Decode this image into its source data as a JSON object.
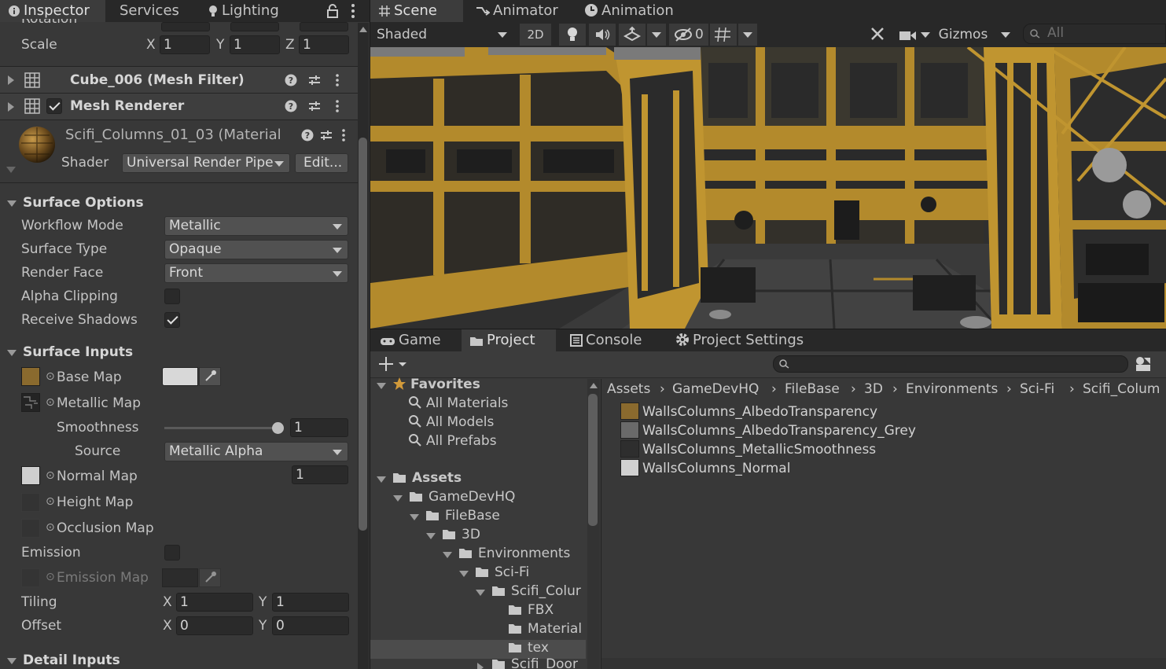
{
  "inspector": {
    "tabs": [
      "Inspector",
      "Services",
      "Lighting"
    ],
    "partial_row_label": "Rotation",
    "scale": {
      "label": "Scale",
      "x": "1",
      "y": "1",
      "z": "1"
    },
    "components": [
      {
        "name": "Cube_006 (Mesh Filter)"
      },
      {
        "name": "Mesh Renderer"
      }
    ],
    "material": {
      "name": "Scifi_Columns_01_03 (Material",
      "shader_label": "Shader",
      "shader_value": "Universal Render Pipe",
      "edit_label": "Edit..."
    },
    "surface_options": {
      "header": "Surface Options",
      "workflow_mode": {
        "label": "Workflow Mode",
        "value": "Metallic"
      },
      "surface_type": {
        "label": "Surface Type",
        "value": "Opaque"
      },
      "render_face": {
        "label": "Render Face",
        "value": "Front"
      },
      "alpha_clipping": {
        "label": "Alpha Clipping",
        "checked": false
      },
      "receive_shadows": {
        "label": "Receive Shadows",
        "checked": true
      }
    },
    "surface_inputs": {
      "header": "Surface Inputs",
      "base_map": "Base Map",
      "metallic_map": "Metallic Map",
      "smoothness": {
        "label": "Smoothness",
        "value": "1",
        "level": 1.0
      },
      "source": {
        "label": "Source",
        "value": "Metallic Alpha"
      },
      "normal_map": {
        "label": "Normal Map",
        "value": "1"
      },
      "height_map": "Height Map",
      "occlusion_map": "Occlusion Map",
      "emission": "Emission",
      "emission_map": "Emission Map",
      "tiling": {
        "label": "Tiling",
        "x": "1",
        "y": "1"
      },
      "offset": {
        "label": "Offset",
        "x": "0",
        "y": "0"
      }
    },
    "detail_inputs": {
      "header": "Detail Inputs"
    },
    "axis_labels": {
      "x": "X",
      "y": "Y",
      "z": "Z"
    }
  },
  "scene": {
    "tabs": [
      "Scene",
      "Animator",
      "Animation"
    ],
    "shading_mode": "Shaded",
    "mode_2d": "2D",
    "hidden_count": "0",
    "gizmos": "Gizmos",
    "search_placeholder": "All"
  },
  "project": {
    "tabs": [
      "Game",
      "Project",
      "Console",
      "Project Settings"
    ],
    "favorites": {
      "label": "Favorites",
      "items": [
        "All Materials",
        "All Models",
        "All Prefabs"
      ]
    },
    "tree": {
      "assets": "Assets",
      "gamedevhq": "GameDevHQ",
      "filebase": "FileBase",
      "three_d": "3D",
      "environments": "Environments",
      "scifi": "Sci-Fi",
      "scifi_columns": "Scifi_Colur",
      "fbx": "FBX",
      "material": "Material",
      "tex": "tex",
      "scifi_door": "Scifi_Door"
    },
    "breadcrumb": [
      "Assets",
      "GameDevHQ",
      "FileBase",
      "3D",
      "Environments",
      "Sci-Fi",
      "Scifi_Colum"
    ],
    "files": [
      {
        "name": "WallsColumns_AlbedoTransparency",
        "color": "#8a6a2e"
      },
      {
        "name": "WallsColumns_AlbedoTransparency_Grey",
        "color": "#6a6a6a"
      },
      {
        "name": "WallsColumns_MetallicSmoothness",
        "color": "#2e2e2e"
      },
      {
        "name": "WallsColumns_Normal",
        "color": "#d0d0d0"
      }
    ]
  },
  "colors": {
    "accent_yellow": "#b8902a",
    "panel": "#383838",
    "toolbar": "#282828"
  }
}
